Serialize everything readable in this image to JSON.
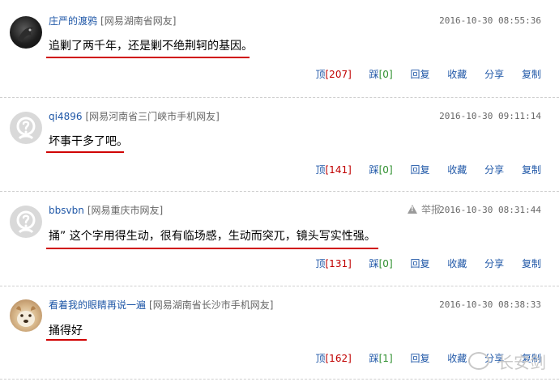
{
  "comments": [
    {
      "username": "庄严的渡鸦",
      "location": "[网易湖南省网友]",
      "time": "2016-10-30 08:55:36",
      "text": "追剿了两千年，还是剿不绝荆轲的基因。",
      "up_label": "顶",
      "up_count": "[207]",
      "down_label": "踩",
      "down_count": "[0]",
      "reply": "回复",
      "favorite": "收藏",
      "share": "分享",
      "copy": "复制"
    },
    {
      "username": "qi4896",
      "location": "[网易河南省三门峡市手机网友]",
      "time": "2016-10-30 09:11:14",
      "text": "坏事干多了吧。",
      "up_label": "顶",
      "up_count": "[141]",
      "down_label": "踩",
      "down_count": "[0]",
      "reply": "回复",
      "favorite": "收藏",
      "share": "分享",
      "copy": "复制"
    },
    {
      "username": "bbsvbn",
      "location": "[网易重庆市网友]",
      "report": "举报",
      "time": "2016-10-30 08:31:44",
      "text": "捅” 这个字用得生动，很有临场感，生动而突兀，镜头写实性强。",
      "up_label": "顶",
      "up_count": "[131]",
      "down_label": "踩",
      "down_count": "[0]",
      "reply": "回复",
      "favorite": "收藏",
      "share": "分享",
      "copy": "复制"
    },
    {
      "username": "看着我的眼睛再说一遍",
      "location": "[网易湖南省长沙市手机网友]",
      "time": "2016-10-30 08:38:33",
      "text": "捅得好",
      "up_label": "顶",
      "up_count": "[162]",
      "down_label": "踩",
      "down_count": "[1]",
      "reply": "回复",
      "favorite": "收藏",
      "share": "分享",
      "copy": "复制"
    }
  ],
  "watermark": "长安剑",
  "colors": {
    "link": "#1f57a7",
    "underline": "#d00000",
    "count_red": "#c00000",
    "count_green": "#2f8f2f"
  }
}
